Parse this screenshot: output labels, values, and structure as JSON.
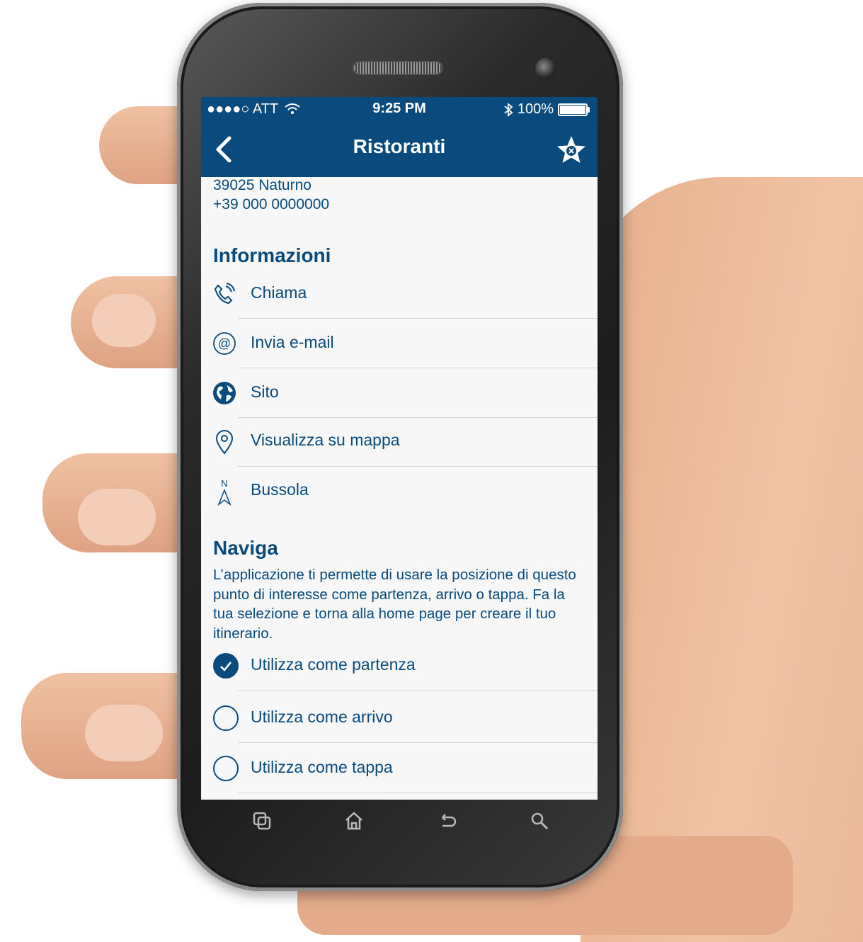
{
  "status_bar": {
    "carrier": "●●●●○ ATT",
    "time": "9:25 PM",
    "battery_text": "100%",
    "battery_level": 1.0
  },
  "nav": {
    "title": "Ristoranti",
    "back_icon": "chevron-left-icon",
    "favorite_icon": "star-remove-icon"
  },
  "address": {
    "line1": "39025 Naturno",
    "phone": "+39 000 0000000"
  },
  "informazioni": {
    "title": "Informazioni",
    "items": [
      {
        "label": "Chiama",
        "icon": "phone-call-icon"
      },
      {
        "label": "Invia e-mail",
        "icon": "at-sign-icon"
      },
      {
        "label": "Sito",
        "icon": "globe-icon"
      },
      {
        "label": "Visualizza su mappa",
        "icon": "map-pin-icon"
      },
      {
        "label": "Bussola",
        "icon": "compass-icon"
      }
    ]
  },
  "naviga": {
    "title": "Naviga",
    "description": "L’applicazione ti permette di usare la posizione di questo punto di interesse come partenza, arrivo o tappa. Fa la tua selezione e torna alla home page per creare il tuo itinerario.",
    "options": [
      {
        "label": "Utilizza come partenza",
        "checked": true
      },
      {
        "label": "Utilizza come arrivo",
        "checked": false
      },
      {
        "label": "Utilizza come tappa",
        "checked": false
      }
    ]
  },
  "hardware_buttons": [
    "recent-apps-icon",
    "home-icon",
    "back-icon",
    "search-icon"
  ],
  "colors": {
    "primary": "#0b4a7c",
    "background": "#f7f7f7",
    "divider": "#d5d5d5"
  }
}
